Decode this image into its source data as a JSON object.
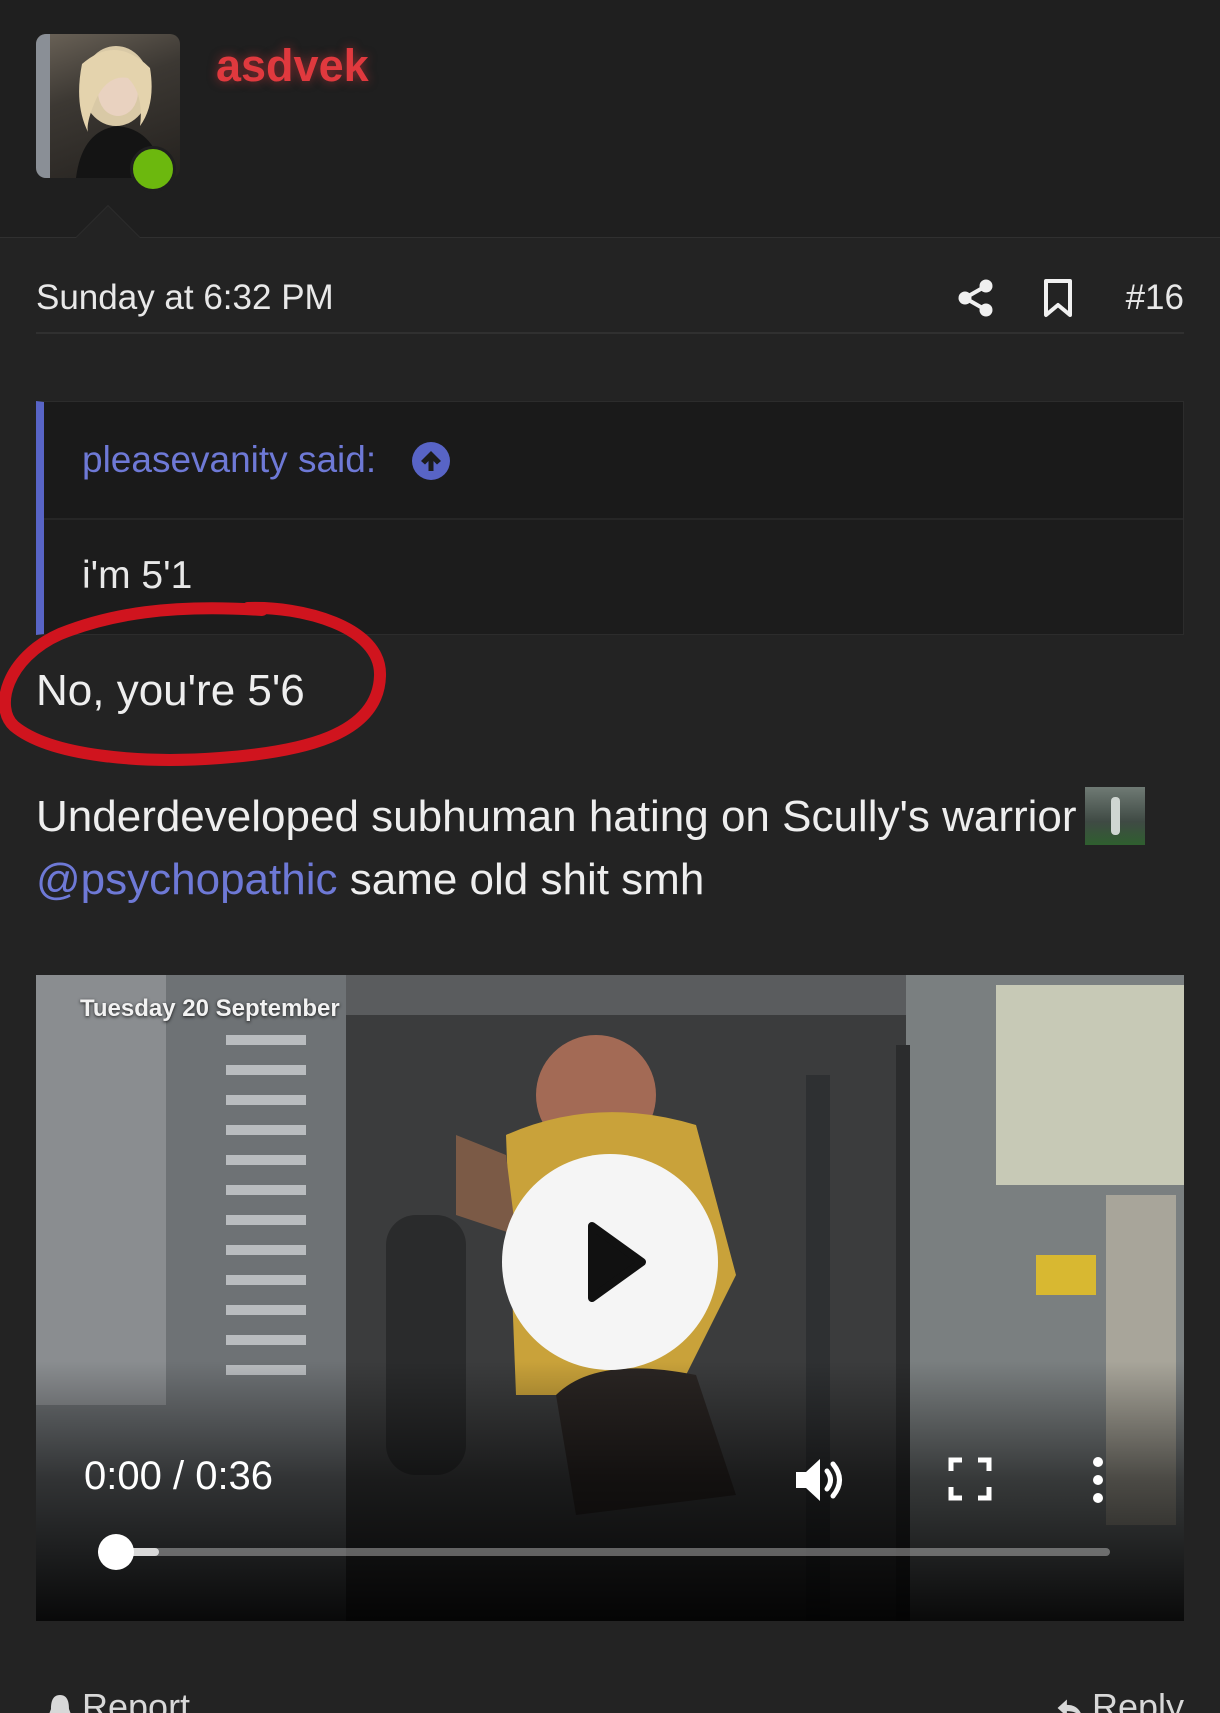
{
  "post": {
    "username": "asdvek",
    "date": "Sunday at 6:32 PM",
    "post_number": "#16",
    "icons": {
      "share": "share-icon",
      "bookmark": "bookmark-icon",
      "online_status": "online-dot"
    }
  },
  "quote": {
    "author": "pleasevanity said:",
    "body": "i'm 5'1",
    "icon": "arrow-up-circle-icon"
  },
  "content": {
    "reply_line": "No, you're 5'6",
    "line1": "Underdeveloped subhuman hating on Scully's warrior",
    "mention": "@psychopathic",
    "line2_rest": " same old shit smh"
  },
  "video": {
    "caption": "Tuesday 20 September",
    "time": "0:00 / 0:36",
    "progress_fraction": 0.0,
    "buffered_fraction": 0.06,
    "icons": [
      "play-icon",
      "volume-icon",
      "fullscreen-icon",
      "more-vertical-icon"
    ]
  },
  "actions": {
    "report_label": "Report",
    "reply_label": "Reply"
  },
  "colors": {
    "background": "#232323",
    "username": "#e0393e",
    "accent": "#5864c6",
    "link": "#6e79d6",
    "online": "#6cb80e",
    "annotation": "#d0141e"
  }
}
